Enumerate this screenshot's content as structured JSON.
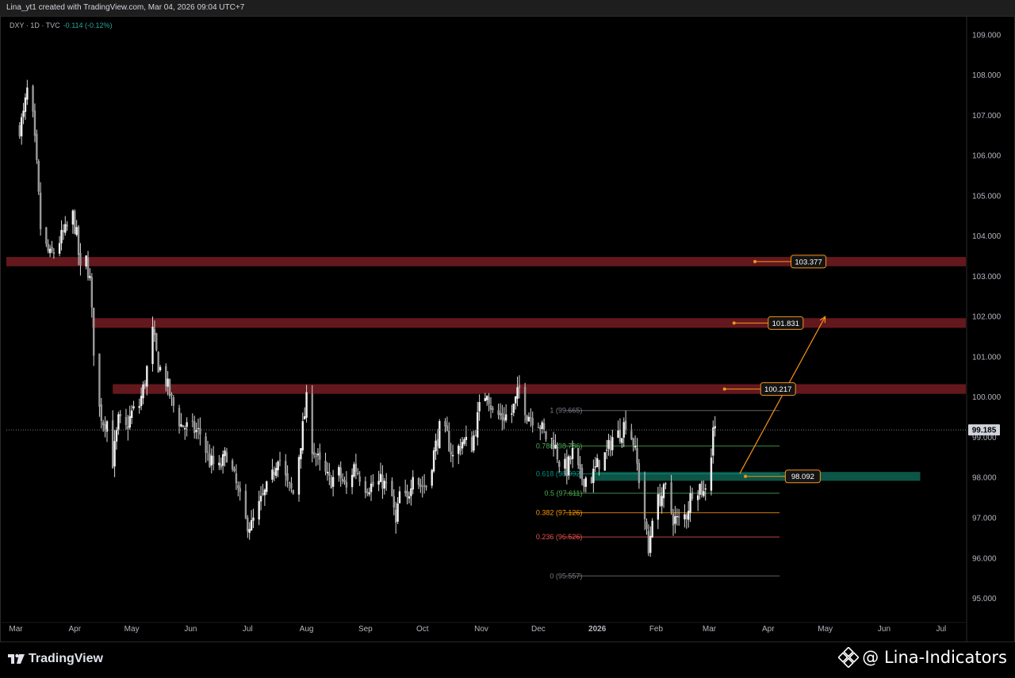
{
  "header": {
    "credit": "Lina_yt1 created with TradingView.com, Mar 04, 2026 09:04 UTC+7"
  },
  "legend": {
    "symbol": "DXY · 1D · TVC",
    "change": "-0.114 (-0.12%)"
  },
  "footer": {
    "logo_text": "TradingView",
    "watermark": "@ Lina-Indicators"
  },
  "colors": {
    "background": "#000000",
    "candle": "#d9d9d9",
    "resistance_zone": "#6b1a20",
    "support_zone": "#0e5a4a",
    "label_border": "#f7931a",
    "projection": "#f7931a"
  },
  "chart_data": {
    "type": "candlestick",
    "title": "",
    "y_axis": {
      "ticks": [
        "109.000",
        "108.000",
        "107.000",
        "106.000",
        "105.000",
        "104.000",
        "103.000",
        "102.000",
        "101.000",
        "100.000",
        "99.000",
        "98.000",
        "97.000",
        "96.000",
        "95.000"
      ],
      "range": [
        94.4,
        109.45
      ]
    },
    "x_axis": {
      "ticks": [
        "Mar",
        "Apr",
        "May",
        "Jun",
        "Jul",
        "Aug",
        "Sep",
        "Oct",
        "Nov",
        "Dec",
        "2026",
        "Feb",
        "Mar",
        "Apr",
        "May",
        "Jun",
        "Jul"
      ],
      "range": [
        "2025-02-24",
        "2026-07-14"
      ]
    },
    "current_price": "99.185",
    "price_path": [
      [
        "2025-03-03",
        106.7
      ],
      [
        "2025-03-05",
        107.0
      ],
      [
        "2025-03-07",
        107.6
      ],
      [
        "2025-03-10",
        106.9
      ],
      [
        "2025-03-12",
        105.7
      ],
      [
        "2025-03-14",
        104.2
      ],
      [
        "2025-03-17",
        103.7
      ],
      [
        "2025-03-19",
        103.5
      ],
      [
        "2025-03-21",
        103.6
      ],
      [
        "2025-03-24",
        103.9
      ],
      [
        "2025-03-27",
        104.1
      ],
      [
        "2025-03-31",
        104.5
      ],
      [
        "2025-04-02",
        104.0
      ],
      [
        "2025-04-04",
        103.1
      ],
      [
        "2025-04-07",
        103.4
      ],
      [
        "2025-04-09",
        102.9
      ],
      [
        "2025-04-11",
        101.2
      ],
      [
        "2025-04-14",
        99.7
      ],
      [
        "2025-04-16",
        99.4
      ],
      [
        "2025-04-18",
        99.4
      ],
      [
        "2025-04-21",
        98.4
      ],
      [
        "2025-04-24",
        99.4
      ],
      [
        "2025-04-28",
        99.2
      ],
      [
        "2025-05-01",
        99.6
      ],
      [
        "2025-05-05",
        99.8
      ],
      [
        "2025-05-08",
        100.4
      ],
      [
        "2025-05-12",
        101.6
      ],
      [
        "2025-05-15",
        100.8
      ],
      [
        "2025-05-19",
        100.4
      ],
      [
        "2025-05-22",
        99.9
      ],
      [
        "2025-05-27",
        99.3
      ],
      [
        "2025-06-02",
        99.2
      ],
      [
        "2025-06-06",
        99.1
      ],
      [
        "2025-06-11",
        98.4
      ],
      [
        "2025-06-16",
        98.2
      ],
      [
        "2025-06-20",
        98.6
      ],
      [
        "2025-06-25",
        97.8
      ],
      [
        "2025-06-30",
        96.9
      ],
      [
        "2025-07-03",
        96.8
      ],
      [
        "2025-07-08",
        97.4
      ],
      [
        "2025-07-14",
        98.0
      ],
      [
        "2025-07-17",
        98.6
      ],
      [
        "2025-07-22",
        97.8
      ],
      [
        "2025-07-25",
        97.6
      ],
      [
        "2025-07-29",
        98.9
      ],
      [
        "2025-08-01",
        99.9
      ],
      [
        "2025-08-04",
        98.8
      ],
      [
        "2025-08-08",
        98.3
      ],
      [
        "2025-08-13",
        97.9
      ],
      [
        "2025-08-18",
        98.1
      ],
      [
        "2025-08-22",
        97.7
      ],
      [
        "2025-08-26",
        98.3
      ],
      [
        "2025-09-01",
        97.8
      ],
      [
        "2025-09-05",
        97.8
      ],
      [
        "2025-09-10",
        97.9
      ],
      [
        "2025-09-15",
        97.5
      ],
      [
        "2025-09-17",
        96.8
      ],
      [
        "2025-09-19",
        97.6
      ],
      [
        "2025-09-23",
        97.4
      ],
      [
        "2025-09-26",
        98.2
      ],
      [
        "2025-09-30",
        97.8
      ],
      [
        "2025-10-03",
        97.8
      ],
      [
        "2025-10-08",
        98.8
      ],
      [
        "2025-10-10",
        99.2
      ],
      [
        "2025-10-14",
        99.0
      ],
      [
        "2025-10-17",
        98.5
      ],
      [
        "2025-10-22",
        98.9
      ],
      [
        "2025-10-27",
        98.8
      ],
      [
        "2025-10-31",
        99.7
      ],
      [
        "2025-11-04",
        100.2
      ],
      [
        "2025-11-07",
        99.6
      ],
      [
        "2025-11-12",
        99.5
      ],
      [
        "2025-11-17",
        99.6
      ],
      [
        "2025-11-21",
        100.2
      ],
      [
        "2025-11-25",
        99.6
      ],
      [
        "2025-12-01",
        99.4
      ],
      [
        "2025-12-05",
        99.0
      ],
      [
        "2025-12-09",
        98.9
      ],
      [
        "2025-12-12",
        98.4
      ],
      [
        "2025-12-16",
        98.2
      ],
      [
        "2025-12-19",
        98.6
      ],
      [
        "2025-12-23",
        98.0
      ],
      [
        "2025-12-29",
        98.0
      ],
      [
        "2026-01-02",
        98.4
      ],
      [
        "2026-01-06",
        98.6
      ],
      [
        "2026-01-09",
        99.0
      ],
      [
        "2026-01-13",
        99.1
      ],
      [
        "2026-01-16",
        99.4
      ],
      [
        "2026-01-20",
        98.9
      ],
      [
        "2026-01-22",
        98.3
      ],
      [
        "2026-01-26",
        97.0
      ],
      [
        "2026-01-28",
        96.1
      ],
      [
        "2026-01-30",
        97.1
      ],
      [
        "2026-02-03",
        97.5
      ],
      [
        "2026-02-06",
        97.7
      ],
      [
        "2026-02-10",
        97.0
      ],
      [
        "2026-02-13",
        96.9
      ],
      [
        "2026-02-17",
        97.1
      ],
      [
        "2026-02-20",
        97.7
      ],
      [
        "2026-02-24",
        97.8
      ],
      [
        "2026-02-26",
        97.6
      ],
      [
        "2026-03-02",
        98.6
      ],
      [
        "2026-03-03",
        99.3
      ],
      [
        "2026-03-04",
        99.2
      ]
    ],
    "resistance_zones": [
      {
        "label": "103.377",
        "low": 103.25,
        "high": 103.48,
        "from": "2025-02-24"
      },
      {
        "label": "101.831",
        "low": 101.72,
        "high": 101.96,
        "from": "2025-04-10"
      },
      {
        "label": "100.217",
        "low": 100.08,
        "high": 100.32,
        "from": "2025-04-21"
      }
    ],
    "support_zone": {
      "label": "98.092",
      "low": 97.92,
      "high": 98.14,
      "from": "2025-12-29",
      "to": "2026-06-20"
    },
    "fibonacci": {
      "from": "2025-12-15",
      "to": "2026-04-07",
      "levels": [
        {
          "ratio": "1",
          "label": "1 (99.665)",
          "value": 99.665,
          "color": "#787b86"
        },
        {
          "ratio": "0.786",
          "label": "0.786 (98.786)",
          "value": 98.786,
          "color": "#4caf50"
        },
        {
          "ratio": "0.618",
          "label": "0.618 (98.092)",
          "value": 98.092,
          "color": "#009688"
        },
        {
          "ratio": "0.5",
          "label": "0.5 (97.611)",
          "value": 97.611,
          "color": "#4caf50"
        },
        {
          "ratio": "0.382",
          "label": "0.382 (97.126)",
          "value": 97.126,
          "color": "#ff9800"
        },
        {
          "ratio": "0.236",
          "label": "0.236 (96.526)",
          "value": 96.526,
          "color": "#ef5350"
        },
        {
          "ratio": "0",
          "label": "0 (95.557)",
          "value": 95.557,
          "color": "#787b86"
        }
      ]
    },
    "projection": {
      "from": [
        "2026-03-17",
        98.1
      ],
      "to": [
        "2026-05-01",
        102.0
      ]
    }
  }
}
